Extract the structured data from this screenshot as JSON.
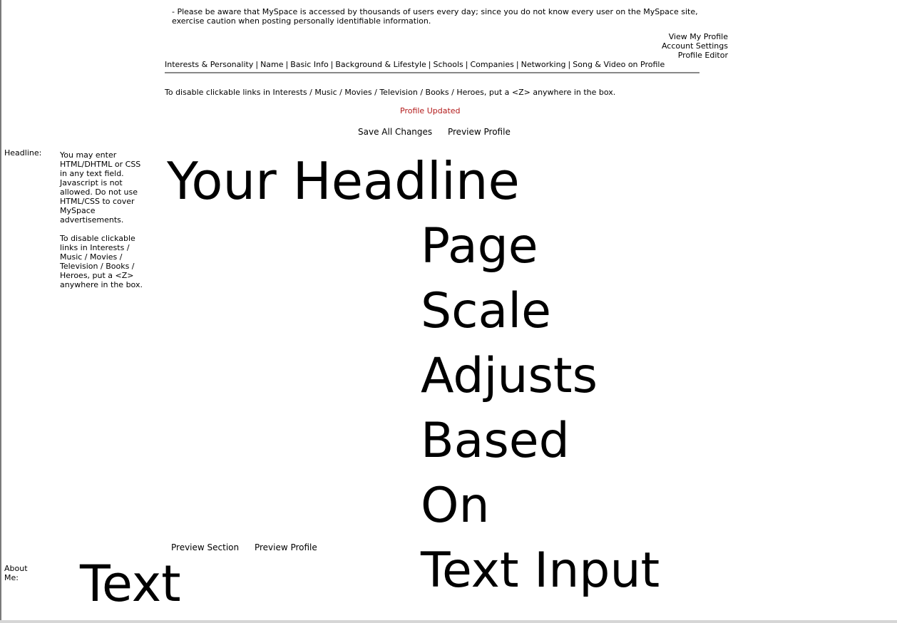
{
  "notice": {
    "line1": "- Please be aware that MySpace is accessed by thousands of users every day; since you do not know every user on the MySpace site,",
    "line2": "exercise caution when posting personally identifiable information."
  },
  "profile_links": {
    "view_profile": "View My Profile",
    "account_settings": "Account Settings",
    "profile_editor": "Profile Editor"
  },
  "tabs": [
    "Interests & Personality",
    "Name",
    "Basic Info",
    "Background & Lifestyle",
    "Schools",
    "Companies",
    "Networking",
    "Song & Video on Profile"
  ],
  "tab_separator": "|",
  "disable_note": "To disable clickable links in Interests / Music / Movies / Television / Books / Heroes, put a <Z> anywhere in the box.",
  "status": "Profile Updated",
  "top_actions": {
    "save": "Save All Changes",
    "preview": "Preview Profile"
  },
  "headline": {
    "label": "Headline:",
    "value": "Your Headline"
  },
  "help": {
    "para1": "You may enter HTML/DHTML or CSS in any text field. Javascript is not allowed. Do not use HTML/CSS to cover MySpace advertisements.",
    "para2": "To disable clickable links in Interests / Music / Movies / Television / Books / Heroes, put a <Z> anywhere in the box."
  },
  "big_stack": [
    "Page",
    "Scale",
    "Adjusts",
    "Based",
    "On",
    "Text Input"
  ],
  "bottom_actions": {
    "preview_section": "Preview Section",
    "preview_profile": "Preview Profile"
  },
  "about": {
    "label": "About Me:",
    "value": "Text"
  },
  "colors": {
    "status": "#b31b1b",
    "divider": "#888888"
  }
}
